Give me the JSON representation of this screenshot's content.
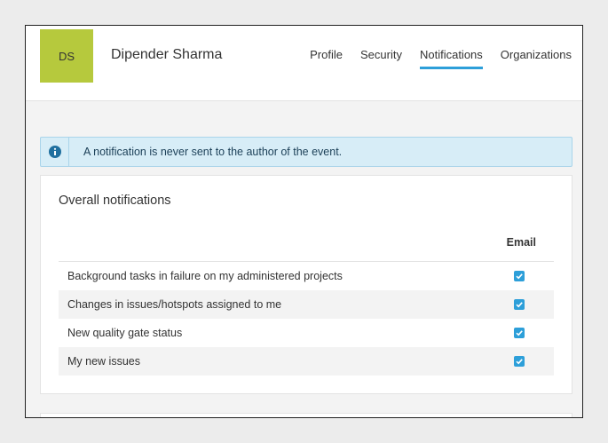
{
  "user": {
    "initials": "DS",
    "name": "Dipender Sharma"
  },
  "nav": [
    {
      "label": "Profile",
      "active": false
    },
    {
      "label": "Security",
      "active": false
    },
    {
      "label": "Notifications",
      "active": true
    },
    {
      "label": "Organizations",
      "active": false
    }
  ],
  "banner": {
    "icon": "info-icon",
    "text": "A notification is never sent to the author of the event."
  },
  "overall": {
    "title": "Overall notifications",
    "column_header": "Email",
    "rows": [
      {
        "label": "Background tasks in failure on my administered projects",
        "email": true
      },
      {
        "label": "Changes in issues/hotspots assigned to me",
        "email": true
      },
      {
        "label": "New quality gate status",
        "email": true
      },
      {
        "label": "My new issues",
        "email": true
      }
    ]
  },
  "colors": {
    "accent": "#2d9fd9",
    "avatar": "#b6c93d",
    "banner_bg": "#d7edf7"
  }
}
